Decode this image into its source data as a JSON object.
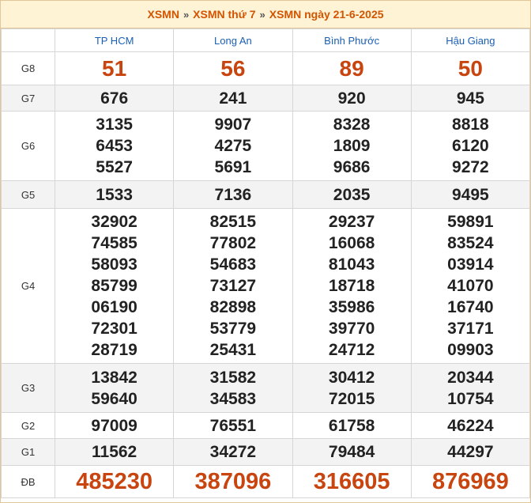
{
  "breadcrumb": {
    "item1": "XSMN",
    "item2": "XSMN thứ 7",
    "item3": "XSMN ngày 21-6-2025",
    "separator": "»"
  },
  "provinces": [
    "TP HCM",
    "Long An",
    "Bình Phước",
    "Hậu Giang"
  ],
  "prizes": [
    {
      "label": "G8",
      "values": [
        [
          "51"
        ],
        [
          "56"
        ],
        [
          "89"
        ],
        [
          "50"
        ]
      ]
    },
    {
      "label": "G7",
      "values": [
        [
          "676"
        ],
        [
          "241"
        ],
        [
          "920"
        ],
        [
          "945"
        ]
      ]
    },
    {
      "label": "G6",
      "values": [
        [
          "3135",
          "6453",
          "5527"
        ],
        [
          "9907",
          "4275",
          "5691"
        ],
        [
          "8328",
          "1809",
          "9686"
        ],
        [
          "8818",
          "6120",
          "9272"
        ]
      ]
    },
    {
      "label": "G5",
      "values": [
        [
          "1533"
        ],
        [
          "7136"
        ],
        [
          "2035"
        ],
        [
          "9495"
        ]
      ]
    },
    {
      "label": "G4",
      "values": [
        [
          "32902",
          "74585",
          "58093",
          "85799",
          "06190",
          "72301",
          "28719"
        ],
        [
          "82515",
          "77802",
          "54683",
          "73127",
          "82898",
          "53779",
          "25431"
        ],
        [
          "29237",
          "16068",
          "81043",
          "18718",
          "35986",
          "39770",
          "24712"
        ],
        [
          "59891",
          "83524",
          "03914",
          "41070",
          "16740",
          "37171",
          "09903"
        ]
      ]
    },
    {
      "label": "G3",
      "values": [
        [
          "13842",
          "59640"
        ],
        [
          "31582",
          "34583"
        ],
        [
          "30412",
          "72015"
        ],
        [
          "20344",
          "10754"
        ]
      ]
    },
    {
      "label": "G2",
      "values": [
        [
          "97009"
        ],
        [
          "76551"
        ],
        [
          "61758"
        ],
        [
          "46224"
        ]
      ]
    },
    {
      "label": "G1",
      "values": [
        [
          "11562"
        ],
        [
          "34272"
        ],
        [
          "79484"
        ],
        [
          "44297"
        ]
      ]
    },
    {
      "label": "ĐB",
      "values": [
        [
          "485230"
        ],
        [
          "387096"
        ],
        [
          "316605"
        ],
        [
          "876969"
        ]
      ]
    }
  ],
  "colors": {
    "accent": "#c8450f",
    "link": "#1a5fb4",
    "header_bg": "#fff3d6",
    "alt_row": "#f3f3f3"
  }
}
